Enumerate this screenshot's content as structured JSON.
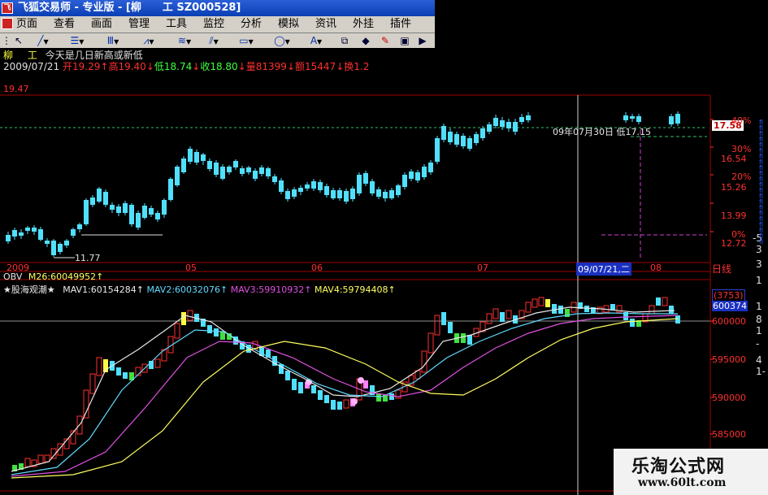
{
  "window": {
    "title": "飞狐交易师 - 专业版 - [柳　　工 SZ000528]"
  },
  "menu": [
    "页面",
    "查看",
    "画面",
    "管理",
    "工具",
    "监控",
    "分析",
    "模拟",
    "资讯",
    "外挂",
    "插件"
  ],
  "toolbar": {
    "text_tool": "A"
  },
  "stock": {
    "name": "柳",
    "name_rest": "工",
    "headline": "今天是几日新高或新低",
    "date": "2009/07/21",
    "open_label": "开",
    "open": "19.29",
    "high_label": "高",
    "high": "19.40",
    "low_label": "低",
    "low": "18.74",
    "close_label": "收",
    "close": "18.80",
    "vol_label": "量",
    "vol": "81399",
    "amount_label": "额",
    "amount": "15447",
    "turnover_label": "换",
    "turnover": "1.2"
  },
  "price_panel": {
    "top_value": "19.47",
    "low_marker": "11.77",
    "crosshair_label": "09年07月30日 低17.15",
    "current_price": "17.58",
    "axis": [
      {
        "pct": "40%"
      },
      {
        "pct": "30%",
        "price": "16.54"
      },
      {
        "pct": "20%",
        "price": "15.26"
      },
      {
        "price": "13.99"
      },
      {
        "pct": "0%",
        "price": "12.72"
      }
    ],
    "date_axis": [
      "2009",
      "05",
      "06",
      "07",
      "08"
    ],
    "date_cursor": "09/07/21,二",
    "period": "日线"
  },
  "obv_panel": {
    "obv_label": "OBV",
    "obv_text": "M26:60049952",
    "title": "★股海观潮★",
    "mav": [
      {
        "text": "MAV1:60154284",
        "color": "#e8e8e8"
      },
      {
        "text": "MAV2:60032076",
        "color": "#60d8ff"
      },
      {
        "text": "MAV3:59910932",
        "color": "#e050e0"
      },
      {
        "text": "MAV4:59794408",
        "color": "#ffff60"
      }
    ],
    "badge_top": "(3753)",
    "badge_value": "600374",
    "axis": [
      "600000",
      "595000",
      "590000",
      "585000"
    ]
  },
  "right_panel_chars": [
    "fi",
    "fi",
    "fi",
    "fi",
    "fi",
    "fi",
    "fi",
    "fi",
    "fi",
    "fi",
    "fi",
    "fi",
    "fi",
    "fi",
    "fi",
    "fi",
    "fi",
    "fi",
    "fi",
    "fi",
    "fi",
    "fi"
  ],
  "right_edge_glyphs": [
    "-5",
    "3",
    "3",
    "1",
    "1",
    "8",
    "1",
    "-",
    "4",
    "1-"
  ],
  "watermark": {
    "title": "乐淘公式网",
    "url": "www.60lt.com"
  },
  "colors": {
    "up": "#ff3030",
    "down": "#50e0ff",
    "grid_red": "#a00000",
    "axis": "#ff3030"
  }
}
